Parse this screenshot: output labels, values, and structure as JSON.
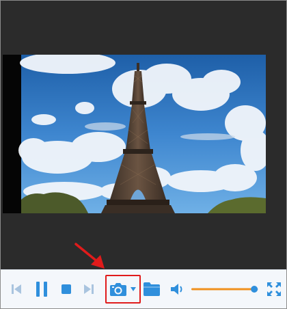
{
  "player": {
    "icons": {
      "prev": "skip-previous-icon",
      "pause": "pause-icon",
      "stop": "stop-icon",
      "next": "skip-next-icon",
      "snapshot": "camera-icon",
      "snapshot_menu": "chevron-down-icon",
      "open_folder": "folder-icon",
      "volume": "speaker-icon",
      "fullscreen": "fullscreen-icon"
    },
    "volume_level": 0.94,
    "colors": {
      "accent": "#2f8fdc",
      "disabled": "#a9c4df",
      "volume_fill": "#f0901e",
      "volume_thumb": "#2f8fdc",
      "highlight_box": "#e01b1b",
      "pointer_arrow": "#e01b1b"
    }
  }
}
